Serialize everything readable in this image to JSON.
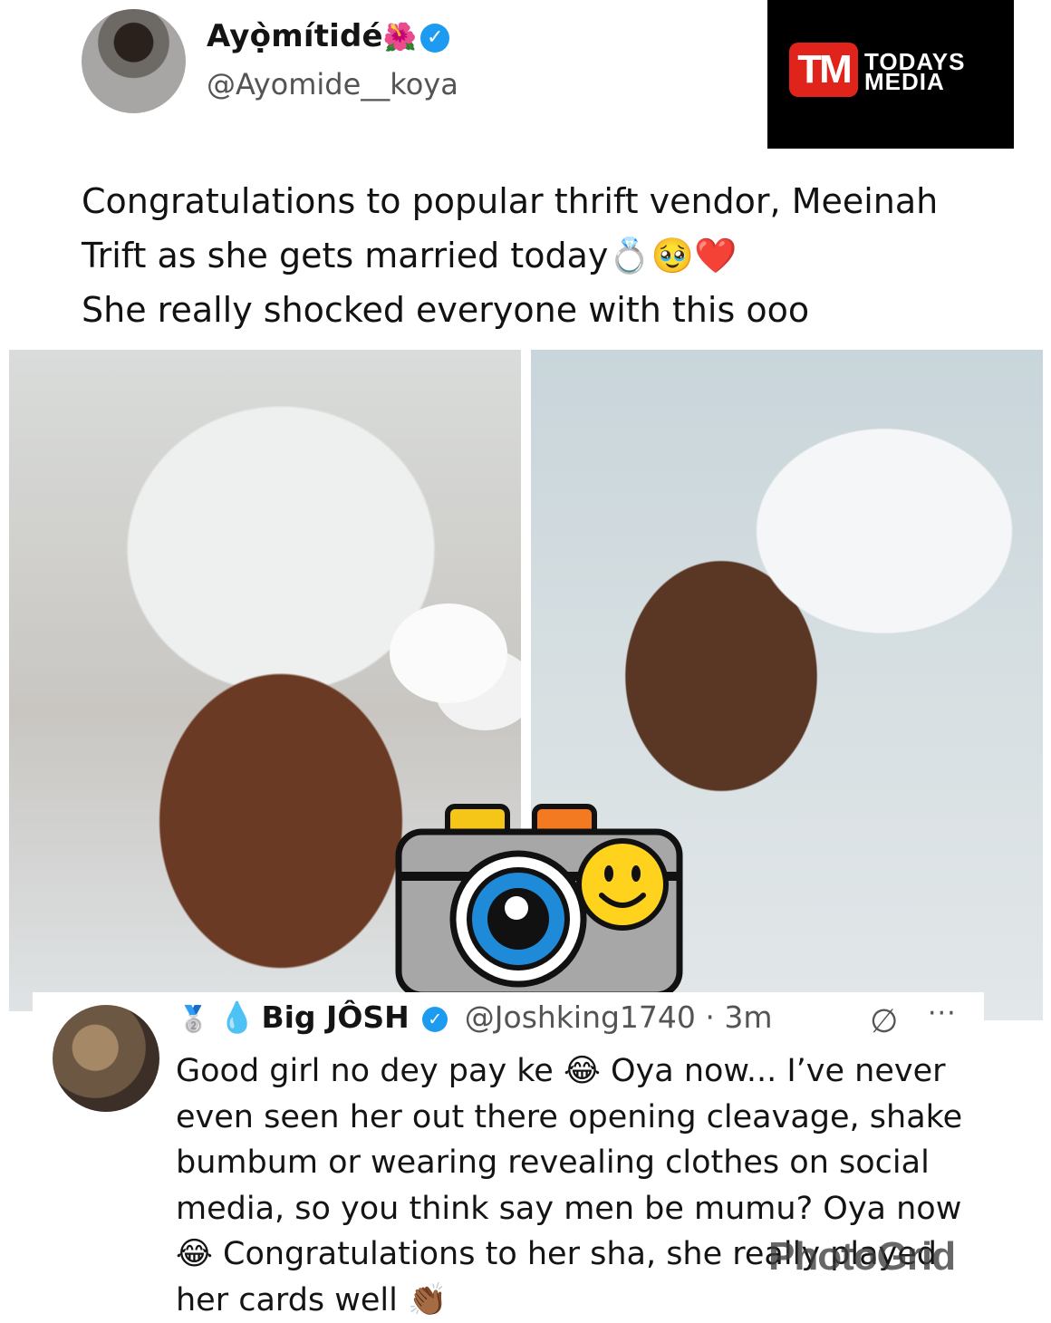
{
  "tweet": {
    "display_name": "Ayọ̀mítidé",
    "name_emoji": "🌺",
    "verified_mark": "✓",
    "handle": "@Ayomide__koya",
    "text_lines": [
      "Congratulations to popular thrift vendor, Meeinah",
      "Trift as she gets married today💍🥹❤️",
      "She really shocked everyone with this ooo"
    ],
    "avatar_icon": "profile-photo",
    "images": [
      "bride-portrait-photo",
      "couple-photo"
    ]
  },
  "logo": {
    "mark": "TM",
    "word1": "TODAYS",
    "word2": "MEDIA"
  },
  "reply": {
    "rank_badge": "🥈",
    "name_emoji": "💧",
    "name": "Big JÔSH",
    "verified_mark": "✓",
    "handle": "@Joshking1740",
    "separator": "·",
    "time": "3m",
    "edit_icon": "∅",
    "more_icon": "···",
    "text_lines": [
      "Good girl no dey pay ke 😂 Oya now... I’ve never",
      "even seen her out there opening cleavage, shake",
      "bumbum or wearing revealing clothes on social",
      "media, so you think say men be mumu? Oya now",
      "😂 Congratulations to her sha, she really played",
      "her cards well 👏🏾"
    ]
  },
  "sticker": "camera-smiley-sticker",
  "watermark": "PhotoGrid",
  "colors": {
    "verified_blue": "#1d9bf0",
    "logo_red": "#e0231b",
    "logo_bg": "#000000"
  }
}
